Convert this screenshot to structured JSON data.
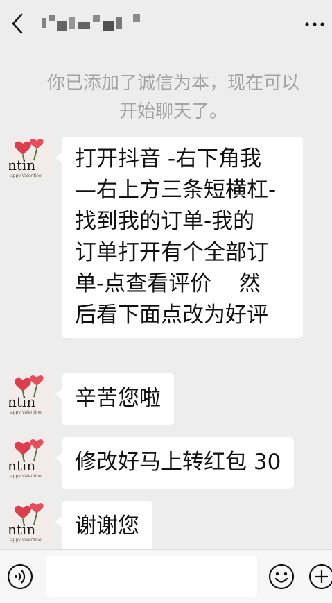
{
  "header": {
    "back_icon": "chevron-left-icon",
    "title_obscured": true,
    "more_icon": "ellipsis-icon"
  },
  "system_notice": {
    "lines": [
      "你已添加了诚信为本，现在可以",
      "开始聊天了。"
    ]
  },
  "messages": [
    {
      "sender": "contact",
      "avatar_icon": "valentine-avatar-icon",
      "lines": [
        "打开抖音 -右下角我",
        "—右上方三条短横杠-",
        "找到我的订单-我的",
        "订单打开有个全部订",
        "单-点查看评价    然",
        "后看下面点改为好评"
      ]
    },
    {
      "sender": "contact",
      "avatar_icon": "valentine-avatar-icon",
      "lines": [
        "辛苦您啦"
      ]
    },
    {
      "sender": "contact",
      "avatar_icon": "valentine-avatar-icon",
      "lines": [
        "修改好马上转红包 30"
      ]
    },
    {
      "sender": "contact",
      "avatar_icon": "valentine-avatar-icon",
      "lines": [
        "谢谢您"
      ]
    }
  ],
  "input_bar": {
    "voice_icon": "voice-icon",
    "text_value": "",
    "emoji_icon": "emoji-icon",
    "plus_icon": "plus-icon"
  },
  "colors": {
    "background": "#ededed",
    "bubble": "#ffffff",
    "system_text": "#a3a3a3",
    "avatar_heart": "#d9404f",
    "avatar_stem": "#4c7a3a"
  }
}
